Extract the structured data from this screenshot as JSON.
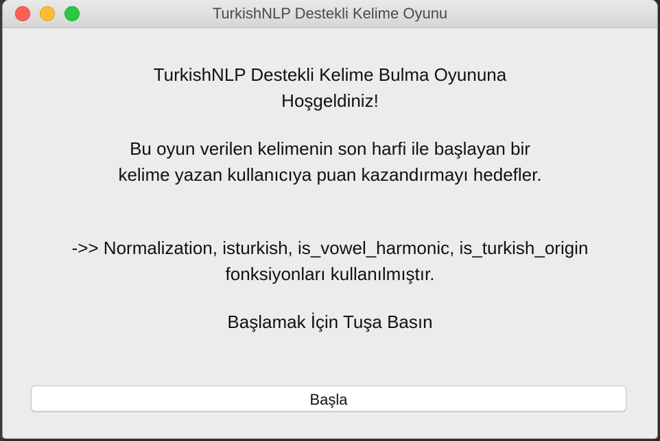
{
  "window": {
    "title": "TurkishNLP Destekli Kelime Oyunu"
  },
  "intro": {
    "welcome_line1": "TurkishNLP Destekli Kelime Bulma Oyununa",
    "welcome_line2": "Hoşgeldiniz!",
    "desc_line1": "Bu oyun verilen kelimenin son harfi ile başlayan bir",
    "desc_line2": "kelime yazan kullanıcıya puan kazandırmayı hedefler.",
    "func_line1": "->> Normalization, isturkish, is_vowel_harmonic, is_turkish_origin",
    "func_line2": "fonksiyonları kullanılmıştır.",
    "prompt": "Başlamak İçin Tuşa Basın"
  },
  "actions": {
    "start_label": "Başla"
  },
  "colors": {
    "close": "#fe5f57",
    "minimize": "#febc2e",
    "maximize": "#28c840",
    "window_bg": "#ececec"
  }
}
